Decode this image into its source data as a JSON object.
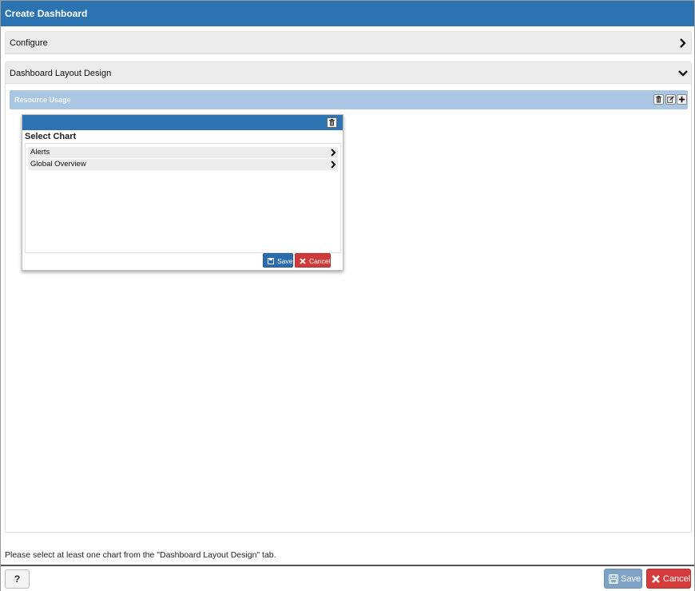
{
  "dialog": {
    "title": "Create Dashboard"
  },
  "accordion": {
    "configure": {
      "label": "Configure"
    },
    "layout": {
      "label": "Dashboard Layout Design"
    }
  },
  "resource_usage": {
    "title": "Resource Usage"
  },
  "widget": {
    "select_title": "Select Chart",
    "items": [
      {
        "label": "Alerts"
      },
      {
        "label": "Global Overview"
      }
    ],
    "save_label": "Save",
    "cancel_label": "Cancel"
  },
  "status": {
    "message": "Please select at least one chart from the \"Dashboard Layout Design\" tab."
  },
  "footer": {
    "help_label": "?",
    "save_label": "Save",
    "cancel_label": "Cancel"
  },
  "colors": {
    "primary": "#2b73b1",
    "panel_header": "#a9c6e2",
    "danger": "#d43b3b",
    "save_disabled": "#7fa3c6"
  }
}
